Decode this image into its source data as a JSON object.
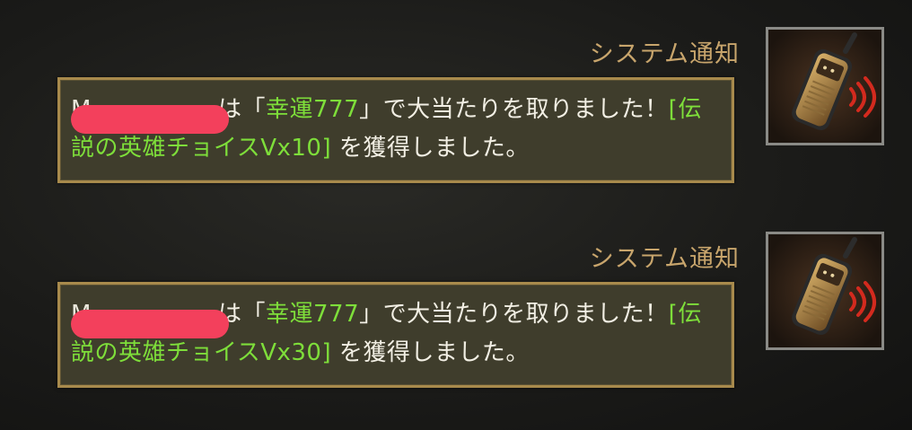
{
  "notifications": [
    {
      "sender": "システム通知",
      "player_visible_prefix": "M",
      "text_before_item": "は「",
      "lottery_name": "幸運777",
      "text_middle": "」で大当たりを取りました！",
      "reward": "[伝説の英雄チョイスⅤx10]",
      "text_after": "を獲得しました。",
      "avatar_icon": "walkie-talkie-icon"
    },
    {
      "sender": "システム通知",
      "player_visible_prefix": "M",
      "text_before_item": "は「",
      "lottery_name": "幸運777",
      "text_middle": "」で大当たりを取りました！",
      "reward": "[伝説の英雄チョイスⅤx30]",
      "text_after": "を獲得しました。",
      "avatar_icon": "walkie-talkie-icon"
    }
  ],
  "colors": {
    "sender": "#c8a56c",
    "highlight": "#7ede3a",
    "message": "#f2efe4",
    "bubble_border": "#a88a4c",
    "redaction": "#f3405c"
  }
}
